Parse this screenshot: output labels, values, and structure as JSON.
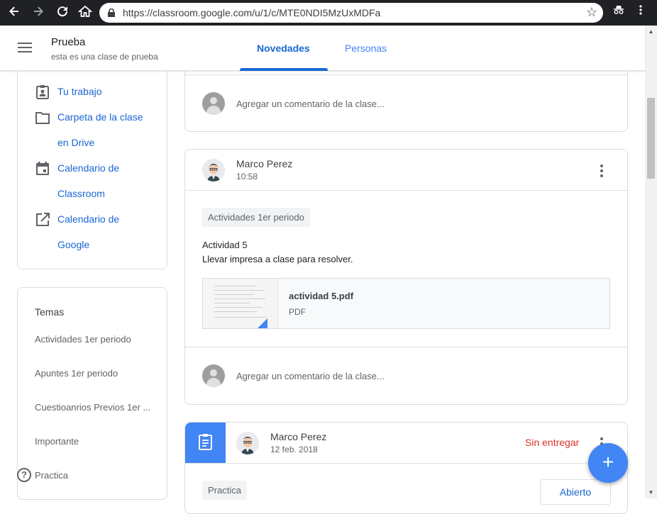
{
  "browser": {
    "url": "https://classroom.google.com/u/1/c/MTE0NDI5MzUxMDFa"
  },
  "header": {
    "class_title": "Prueba",
    "class_subtitle": "esta es una clase de prueba",
    "tabs": [
      {
        "label": "Novedades",
        "active": true
      },
      {
        "label": "Personas",
        "active": false
      }
    ]
  },
  "sidebar": {
    "links": [
      {
        "label": "Tu trabajo",
        "icon": "assignment-ind-icon"
      },
      {
        "label_line1": "Carpeta de la clase",
        "label_line2": "en Drive",
        "icon": "folder-icon"
      },
      {
        "label_line1": "Calendario de",
        "label_line2": "Classroom",
        "icon": "calendar-icon"
      },
      {
        "label_line1": "Calendario de",
        "label_line2": "Google",
        "icon": "open-in-new-icon"
      }
    ],
    "topics_title": "Temas",
    "topics": [
      "Actividades 1er periodo",
      "Apuntes 1er periodo",
      "Cuestioanrios Previos 1er ...",
      "Importante",
      "Practica"
    ]
  },
  "stream": {
    "comment_placeholder": "Agregar un comentario de la clase...",
    "post1": {
      "author": "Marco Perez",
      "time": "10:58",
      "topic": "Actividades 1er periodo",
      "title": "Actividad 5",
      "body": "Llevar impresa a clase para resolver.",
      "attachment_name": "actividad 5.pdf",
      "attachment_type": "PDF"
    },
    "post2": {
      "author": "Marco Perez",
      "date": "12 feb. 2018",
      "status": "Sin entregar",
      "topic": "Practica",
      "status_button": "Abierto"
    }
  },
  "fab_label": "+",
  "help_label": "?",
  "colors": {
    "accent": "#1967d2",
    "brand_blue": "#4285f4",
    "missing": "#d93025"
  }
}
